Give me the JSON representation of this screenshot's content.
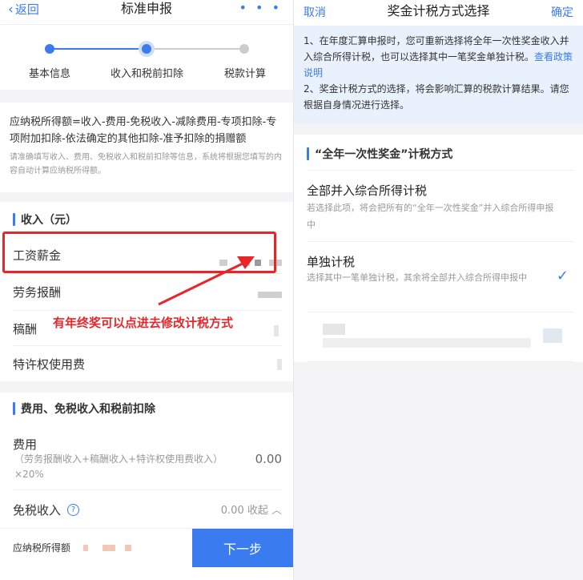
{
  "left": {
    "nav": {
      "back_label": "返回",
      "title": "标准申报",
      "more": "• • •"
    },
    "steps": [
      {
        "label": "基本信息"
      },
      {
        "label": "收入和税前扣除"
      },
      {
        "label": "税款计算"
      }
    ],
    "formula": "应纳税所得额=收入-费用-免税收入-减除费用-专项扣除-专项附加扣除-依法确定的其他扣除-准予扣除的捐赠额",
    "formula_note": "请准确填写收入、费用、免税收入和税前扣除等信息，系统将根据您填写的内容自动计算应纳税所得额。",
    "income_section": {
      "title": "收入（元）",
      "items": [
        {
          "label": "工资薪金"
        },
        {
          "label": "劳务报酬"
        },
        {
          "label": "稿酬"
        },
        {
          "label": "特许权使用费"
        }
      ]
    },
    "annotation": "有年终奖可以点进去修改计税方式",
    "deduction_section": {
      "title": "费用、免税收入和税前扣除",
      "fee": {
        "label": "费用",
        "sub": "（劳务报酬收入+稿酬收入+特许权使用费收入）×20%",
        "value": "0.00"
      },
      "tax_free": {
        "label": "免税收入",
        "help": "?",
        "value": "0.00 收起 ︿"
      }
    },
    "bottom": {
      "label": "应纳税所得额",
      "next_label": "下一步"
    }
  },
  "right": {
    "nav": {
      "cancel_label": "取消",
      "title": "奖金计税方式选择",
      "confirm_label": "确定"
    },
    "notice": {
      "line1": "1、在年度汇算申报时，您可重新选择将全年一次性奖金收入并入综合所得计税，也可以选择其中一笔奖金单独计税。",
      "link": "查看政策说明",
      "line2": "2、奖金计税方式的选择，将会影响汇算的税款计算结果。请您根据自身情况进行选择。"
    },
    "section_title": "“全年一次性奖金”计税方式",
    "options": [
      {
        "title": "全部并入综合所得计税",
        "desc": "若选择此项，将会把所有的“全年一次性奖金”并入综合所得申报中",
        "selected": false
      },
      {
        "title": "单独计税",
        "desc": "选择其中一笔单独计税，其余将全部并入综合所得申报中",
        "selected": true
      }
    ],
    "check_icon": "✓"
  },
  "colors": {
    "accent": "#3a7cf0",
    "annotation": "#e8262a"
  }
}
